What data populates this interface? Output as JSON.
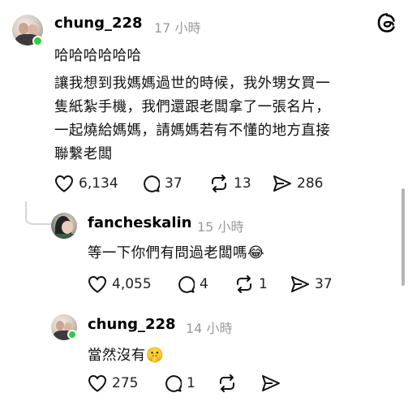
{
  "comments": [
    {
      "username": "chung_228",
      "time": "17 小時",
      "lines": [
        "哈哈哈哈哈哈",
        "讓我想到我媽媽過世的時候，我外甥女買一",
        "隻紙紮手機，我們還跟老闆拿了一張名片，",
        "一起燒給媽媽，請媽媽若有不懂的地方直接",
        "聯繫老闆"
      ],
      "likes": "6,134",
      "replies": "37",
      "reposts": "13",
      "shares": "286"
    },
    {
      "username": "fancheskalin",
      "time": "15 小時",
      "text": "等一下你們有問過老闆嗎",
      "emoji": "😂",
      "likes": "4,055",
      "replies": "4",
      "reposts": "1",
      "shares": "37"
    },
    {
      "username": "chung_228",
      "time": "14 小時",
      "text": "當然沒有",
      "emoji": "🤫",
      "likes": "275",
      "replies": "1",
      "reposts": "",
      "shares": ""
    }
  ],
  "icons": {
    "app": "threads-logo-icon",
    "like": "heart-icon",
    "reply": "comment-icon",
    "repost": "repost-icon",
    "share": "send-icon"
  },
  "colors": {
    "online": "#2ecc40",
    "muted": "#9a9a9a",
    "thread_line": "#d6d6d6"
  }
}
